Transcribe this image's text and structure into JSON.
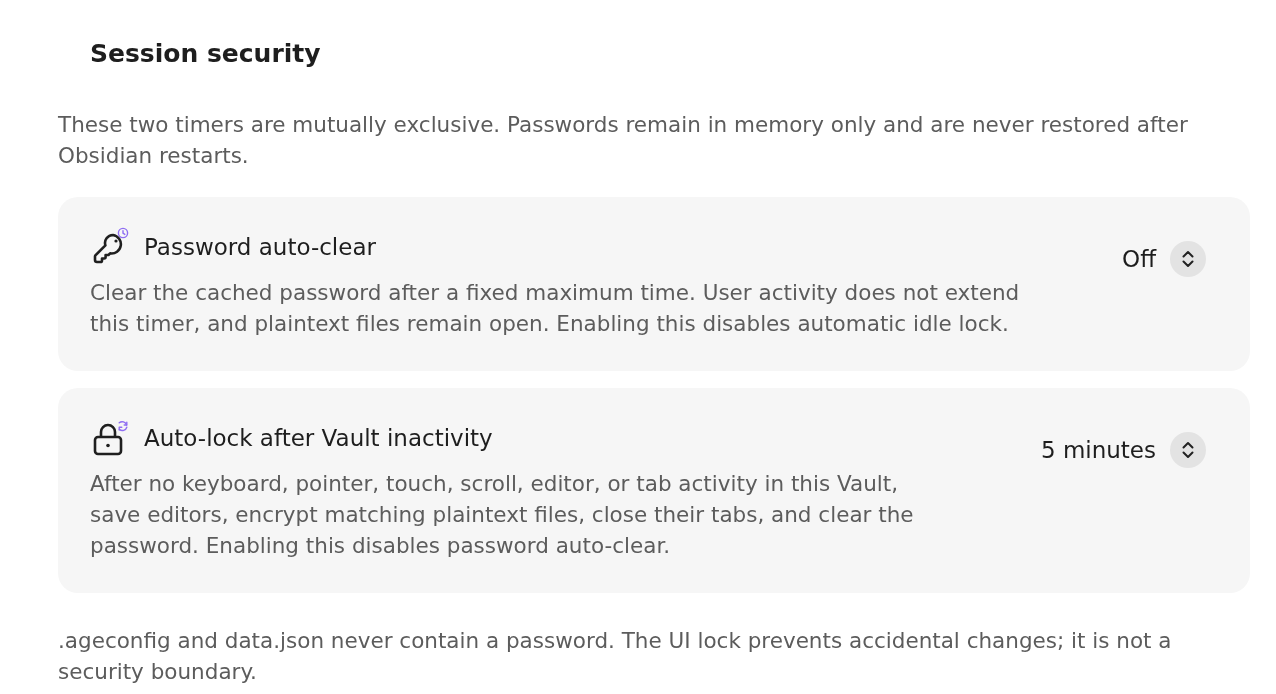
{
  "heading": "Session security",
  "intro": "These two timers are mutually exclusive. Passwords remain in memory only and are never restored after Obsidian restarts.",
  "settings": [
    {
      "kind": "clear",
      "title": "Password auto-clear",
      "description": "Clear the cached password after a fixed maximum time. User activity does not extend this timer, and plaintext files remain open. Enabling this disables automatic idle lock.",
      "value": "Off"
    },
    {
      "kind": "lock",
      "title": "Auto-lock after Vault inactivity",
      "description": "After no keyboard, pointer, touch, scroll, editor, or tab activity in this Vault, save editors, encrypt matching plaintext files, close their tabs, and clear the password. Enabling this disables password auto-clear.",
      "value": "5 minutes"
    }
  ],
  "footer": ".ageconfig and data.json never contain a password. The UI lock prevents accidental changes; it is not a security boundary."
}
